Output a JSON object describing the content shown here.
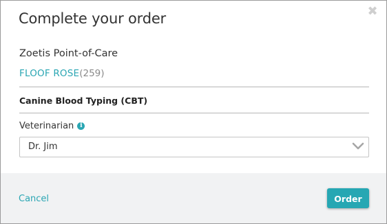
{
  "dialog": {
    "title": "Complete your order",
    "close_icon": "close-icon",
    "close_glyph": "✖"
  },
  "order": {
    "provider": "Zoetis Point-of-Care",
    "patient_name": "FLOOF ROSE",
    "patient_id": "(259)",
    "test_name": "Canine Blood Typing (CBT)"
  },
  "veterinarian": {
    "label": "Veterinarian",
    "info_icon": "info-icon",
    "info_glyph": "i",
    "selected": "Dr. Jim",
    "dropdown_icon": "chevron-down-icon"
  },
  "footer": {
    "cancel_label": "Cancel",
    "order_label": "Order"
  },
  "colors": {
    "accent": "#2aa6b3",
    "button": "#26a7b3",
    "footer_bg": "#f1f2f3",
    "divider": "#b5b5b5"
  }
}
